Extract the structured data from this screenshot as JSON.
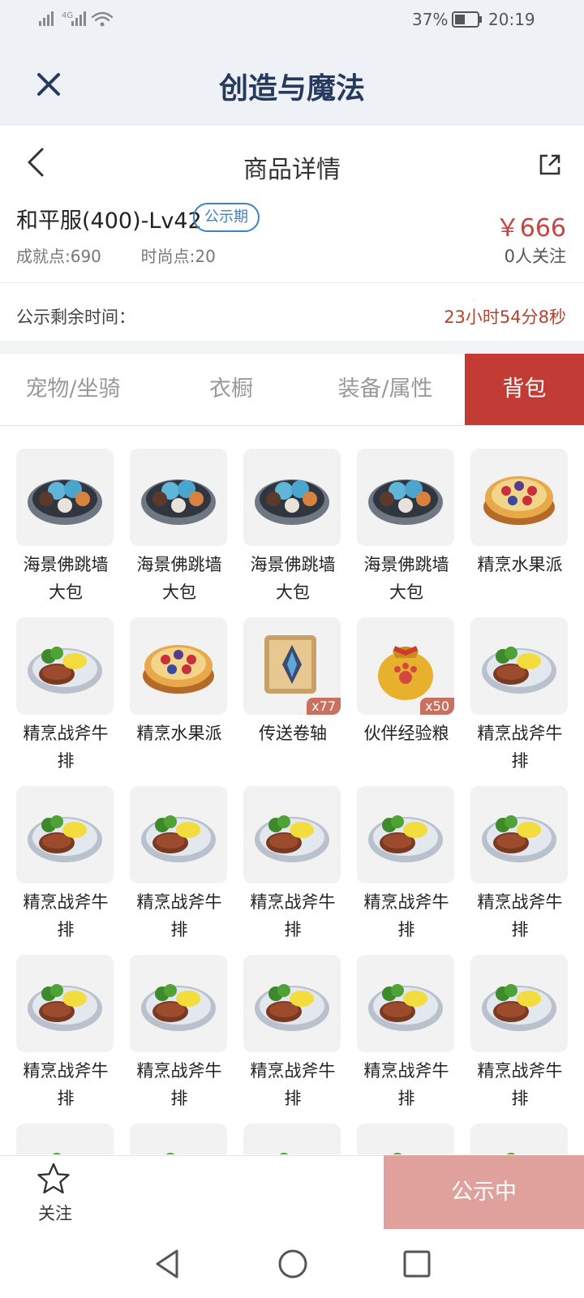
{
  "status_bar": {
    "battery": "37%",
    "time": "20:19",
    "network": "4G"
  },
  "app_title": "创造与魔法",
  "page_title": "商品详情",
  "item": {
    "name": "和平服(400)-Lv42",
    "badge": "公示期",
    "price": "￥666",
    "achievement": "成就点:690",
    "fashion": "时尚点:20",
    "followers": "0人关注"
  },
  "remaining": {
    "label": "公示剩余时间：",
    "value": "23小时54分8秒"
  },
  "tabs": [
    {
      "label": "宠物/坐骑",
      "active": false
    },
    {
      "label": "衣橱",
      "active": false
    },
    {
      "label": "装备/属性",
      "active": false
    },
    {
      "label": "背包",
      "active": true
    }
  ],
  "items": [
    {
      "name": "海景佛跳墙大包",
      "icon": "bun-plate"
    },
    {
      "name": "海景佛跳墙大包",
      "icon": "bun-plate"
    },
    {
      "name": "海景佛跳墙大包",
      "icon": "bun-plate"
    },
    {
      "name": "海景佛跳墙大包",
      "icon": "bun-plate"
    },
    {
      "name": "精烹水果派",
      "icon": "fruit-pie"
    },
    {
      "name": "精烹战斧牛排",
      "icon": "steak-plate"
    },
    {
      "name": "精烹水果派",
      "icon": "fruit-pie"
    },
    {
      "name": "传送卷轴",
      "icon": "scroll",
      "qty": "x77"
    },
    {
      "name": "伙伴经验粮",
      "icon": "food-bag",
      "qty": "x50"
    },
    {
      "name": "精烹战斧牛排",
      "icon": "steak-plate"
    },
    {
      "name": "精烹战斧牛排",
      "icon": "steak-plate"
    },
    {
      "name": "精烹战斧牛排",
      "icon": "steak-plate"
    },
    {
      "name": "精烹战斧牛排",
      "icon": "steak-plate"
    },
    {
      "name": "精烹战斧牛排",
      "icon": "steak-plate"
    },
    {
      "name": "精烹战斧牛排",
      "icon": "steak-plate"
    },
    {
      "name": "精烹战斧牛排",
      "icon": "steak-plate"
    },
    {
      "name": "精烹战斧牛排",
      "icon": "steak-plate"
    },
    {
      "name": "精烹战斧牛排",
      "icon": "steak-plate"
    },
    {
      "name": "精烹战斧牛排",
      "icon": "steak-plate"
    },
    {
      "name": "精烹战斧牛排",
      "icon": "steak-plate"
    },
    {
      "name": "",
      "icon": "steak-plate"
    },
    {
      "name": "",
      "icon": "steak-plate"
    },
    {
      "name": "",
      "icon": "steak-plate"
    },
    {
      "name": "",
      "icon": "steak-plate"
    },
    {
      "name": "",
      "icon": "steak-plate"
    }
  ],
  "bottom": {
    "follow_label": "关注",
    "status_button": "公示中"
  },
  "colors": {
    "accent": "#c23b35",
    "price": "#c8453f",
    "badge": "#3f82c4",
    "status_button": "#e0a19c"
  }
}
